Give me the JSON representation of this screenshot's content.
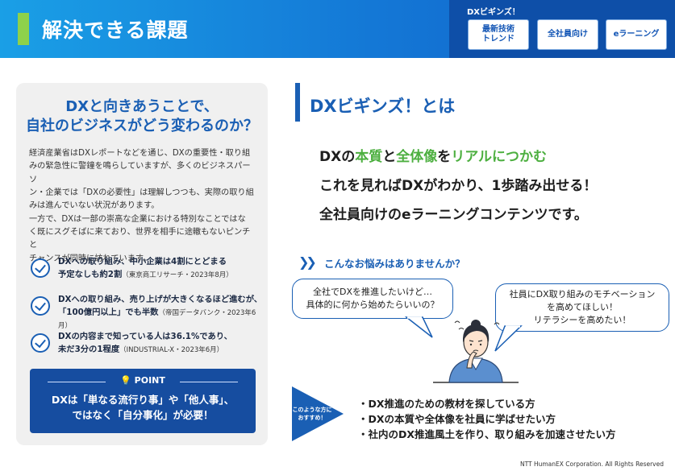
{
  "header": {
    "title": "解決できる課題",
    "nav_label": "DXビギンズ！",
    "nav_buttons": [
      "最新技術\nトレンド",
      "全社員向け",
      "eラーニング"
    ]
  },
  "left": {
    "heading": "DXと向きあうことで、\n自社のビジネスがどう変わるのか？",
    "body": "経済産業省はDXレポートなどを通じ、DXの重要性・取り組\nみの緊急性に警鐘を鳴らしていますが、多くのビジネスパーソ\nン・企業では「DXの必要性」は理解しつつも、実際の取り組\nみは進んでいない状況があります。\n一方で、DXは一部の崇高な企業における特別なことではな\nく既にスグそばに来ており、世界を相手に途轍もないピンチと\nチャンスが同時に訪れています。",
    "checks": [
      {
        "line1": "DXへの取り組み、中小企業は4割にとどまる",
        "line2": "予定なしも約2割",
        "source": "（東京商工リサーチ・2023年8月）"
      },
      {
        "line1": "DXへの取り組み、売り上げが大きくなるほど進むが、",
        "line2": "「100億円以上」でも半数",
        "source": "（帝国データバンク・2023年6月）"
      },
      {
        "line1": "DXの内容まで知っている人は36.1%であり、",
        "line2": "未だ3分の1程度",
        "source": "（INDUSTRIAL-X・2023年6月）"
      }
    ],
    "point_label": "POINT",
    "point_text": "DXは「単なる流行り事」や「他人事」、\nではなく「自分事化」が必要！"
  },
  "right": {
    "heading": "DXビギンズ！とは",
    "tagline1": {
      "p1": "DXの",
      "g1": "本質",
      "p2": "と",
      "g2": "全体像",
      "p3": "を",
      "g3": "リアルにつかむ"
    },
    "tagline2": "これを見ればDXがわかり、1歩踏み出せる！",
    "tagline3": "全社員向けのeラーニングコンテンツです。",
    "concern_title": "こんなお悩みはありませんか？",
    "bubble_left": "全社でDXを推進したいけど…\n具体的に何から始めたらいいの？",
    "bubble_right": "社員にDX取り組みのモチベーション\nを高めてほしい！\nリテラシーを高めたい！",
    "recommend_label": "このような方に\nおすすめ！",
    "recommend_items": [
      "・DX推進のための教材を探している方",
      "・DXの本質や全体像を社員に学ばせたい方",
      "・社内のDX推進風土を作り、取り組みを加速させたい方"
    ]
  },
  "footer": "NTT HumanEX Corporation. All Rights Reserved",
  "colors": {
    "brand_blue": "#1a5fb4",
    "accent_green": "#4caf3f",
    "header_accent": "#8ed14b"
  }
}
